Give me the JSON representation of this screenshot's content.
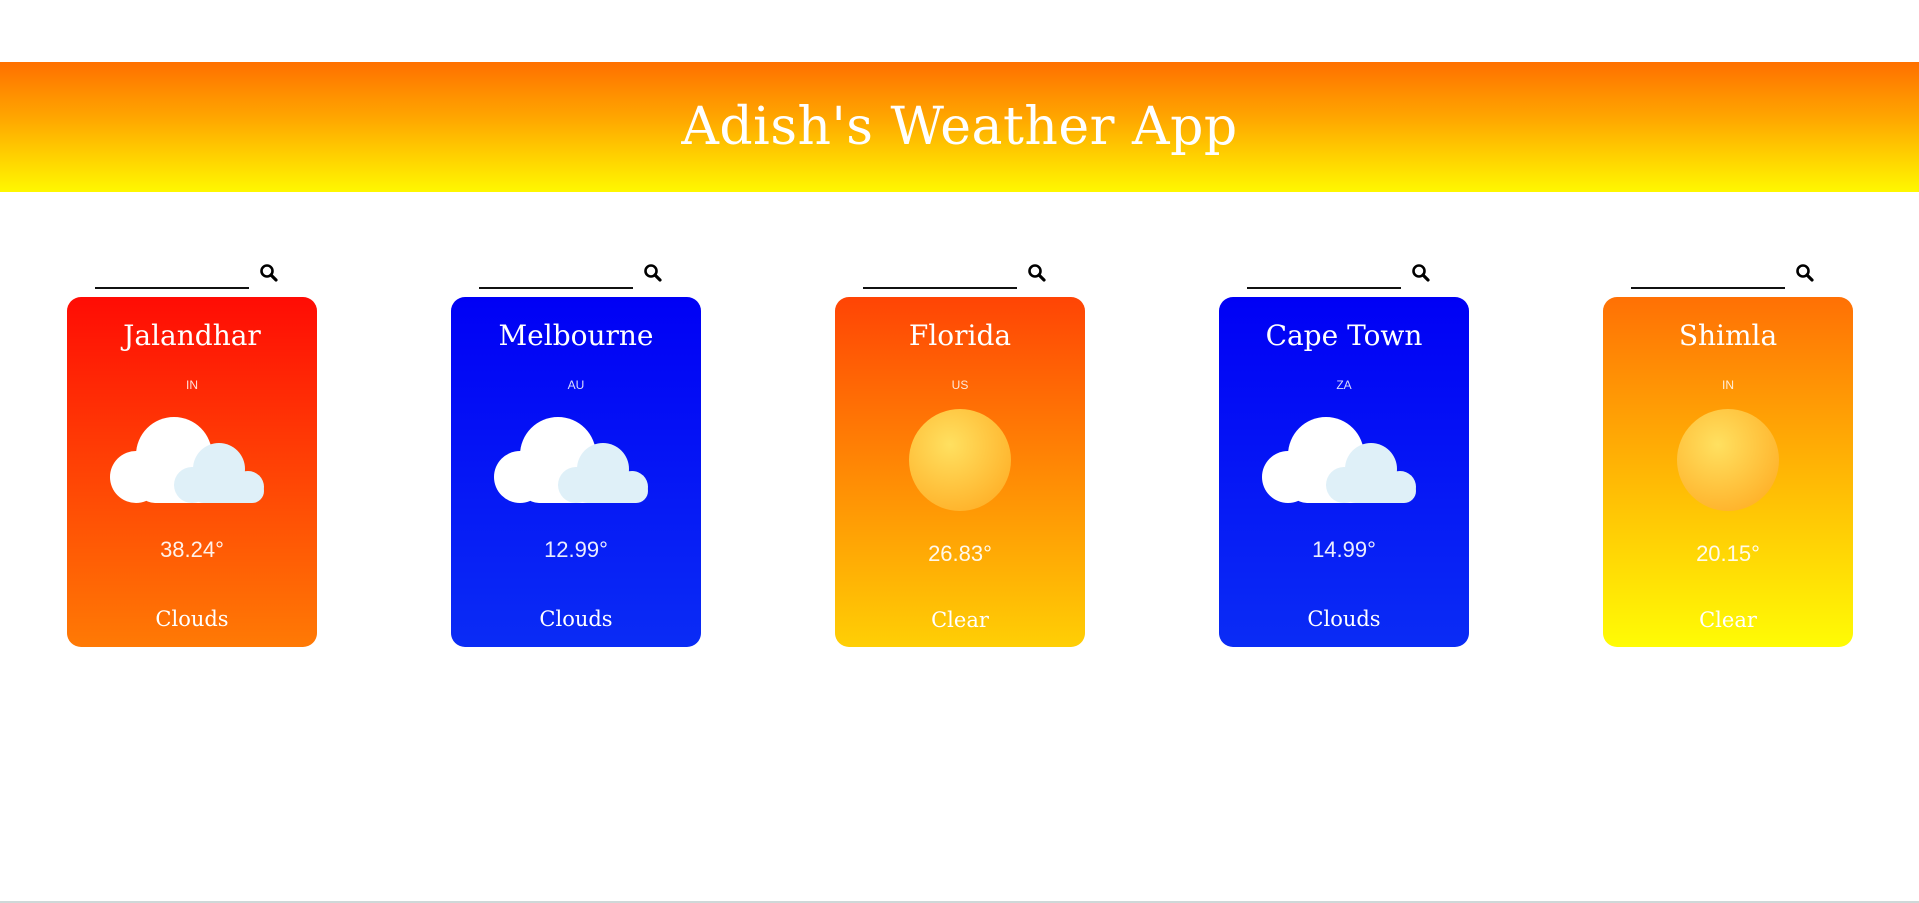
{
  "header": {
    "title": "Adish's Weather App",
    "gradient": [
      "#ff7000",
      "#ffa900",
      "#fff800"
    ]
  },
  "cards": [
    {
      "search_value": "",
      "search_icon": "search-icon",
      "city": "Jalandhar",
      "country": "IN",
      "weather_icon": "clouds-icon",
      "temperature": "38.24°",
      "condition": "Clouds",
      "colors": [
        "#ff0c05",
        "#ff7a05"
      ]
    },
    {
      "search_value": "",
      "search_icon": "search-icon",
      "city": "Melbourne",
      "country": "AU",
      "weather_icon": "clouds-icon",
      "temperature": "12.99°",
      "condition": "Clouds",
      "colors": [
        "#0000f5",
        "#0a2cf5"
      ]
    },
    {
      "search_value": "",
      "search_icon": "search-icon",
      "city": "Florida",
      "country": "US",
      "weather_icon": "sun-icon",
      "temperature": "26.83°",
      "condition": "Clear",
      "colors": [
        "#ff4405",
        "#ffcf05"
      ]
    },
    {
      "search_value": "",
      "search_icon": "search-icon",
      "city": "Cape Town",
      "country": "ZA",
      "weather_icon": "clouds-icon",
      "temperature": "14.99°",
      "condition": "Clouds",
      "colors": [
        "#0000f5",
        "#0a2cf5"
      ]
    },
    {
      "search_value": "",
      "search_icon": "search-icon",
      "city": "Shimla",
      "country": "IN",
      "weather_icon": "sun-icon",
      "temperature": "20.15°",
      "condition": "Clear",
      "colors": [
        "#ff7005",
        "#fffc05"
      ]
    }
  ]
}
